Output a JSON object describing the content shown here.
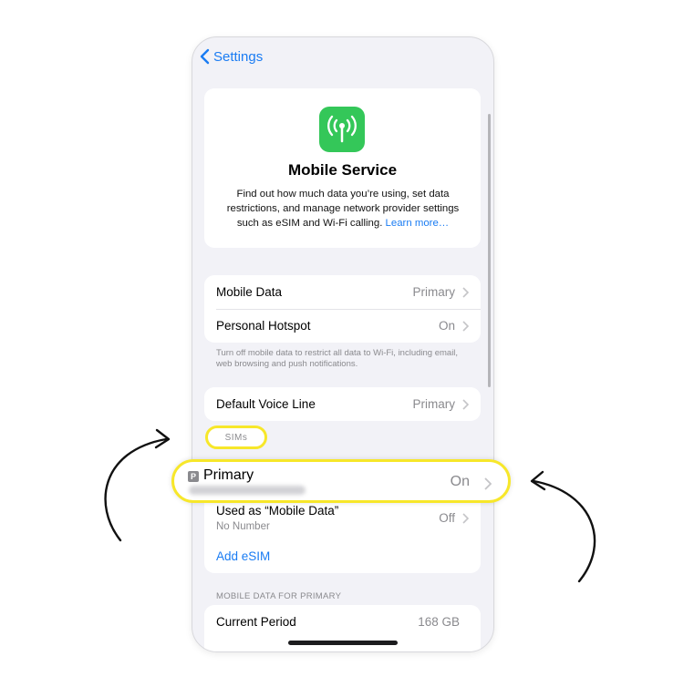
{
  "nav": {
    "back_label": "Settings"
  },
  "hero": {
    "icon": "antenna-icon",
    "title": "Mobile Service",
    "description": "Find out how much data you’re using, set data restrictions, and manage network provider settings such as eSIM and Wi-Fi calling.",
    "learn_more": "Learn more…"
  },
  "data_group": {
    "rows": [
      {
        "label": "Mobile Data",
        "value": "Primary"
      },
      {
        "label": "Personal Hotspot",
        "value": "On"
      }
    ],
    "footnote": "Turn off mobile data to restrict all data to Wi-Fi, including email, web browsing and push notifications."
  },
  "voice_group": {
    "label": "Default Voice Line",
    "value": "Primary"
  },
  "sims": {
    "header": "SIMs",
    "primary": {
      "badge": "P",
      "label": "Primary",
      "value": "On"
    },
    "secondary": {
      "label": "Used as “Mobile Data”",
      "sub": "No Number",
      "value": "Off"
    },
    "add_esim": "Add eSIM"
  },
  "usage": {
    "header": "MOBILE DATA FOR PRIMARY",
    "rows": [
      {
        "label": "Current Period",
        "value": "168 GB"
      }
    ]
  },
  "colors": {
    "accent": "#1a7cf3",
    "icon_green": "#34c759",
    "highlight": "#f7e72a"
  }
}
